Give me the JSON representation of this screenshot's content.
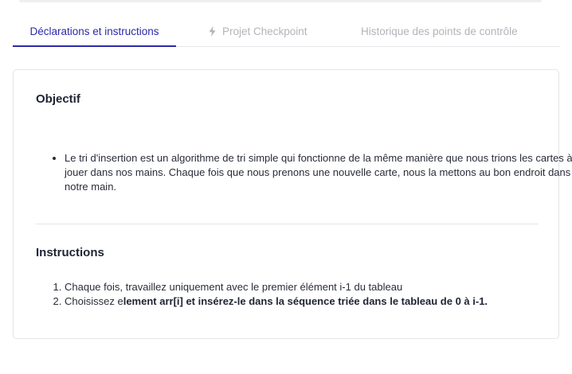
{
  "tabs": [
    {
      "label": "Déclarations et instructions",
      "active": true
    },
    {
      "label": "Projet Checkpoint",
      "icon": "lightning-bolt-icon",
      "active": false
    },
    {
      "label": "Historique des points de contrôle",
      "active": false
    }
  ],
  "objective": {
    "heading": "Objectif",
    "bullets": [
      "Le tri d'insertion est un algorithme de tri simple qui fonctionne de la même manière que nous trions les cartes à jouer dans nos mains. Chaque fois que nous prenons une nouvelle carte, nous la mettons au bon endroit dans notre main."
    ]
  },
  "instructions": {
    "heading": "Instructions",
    "items": [
      {
        "text": "Chaque fois, travaillez uniquement avec le premier élément i-1 du tableau"
      },
      {
        "prefix": "Choisissez e",
        "bold": "lement arr[i] et insérez-le dans la séquence triée dans le tableau de 0 à i-1."
      }
    ]
  },
  "colors": {
    "accent": "#2c2aa8",
    "inactive_tab": "#b3b3bb",
    "text": "#1f2333",
    "border": "#e5e5e9"
  }
}
